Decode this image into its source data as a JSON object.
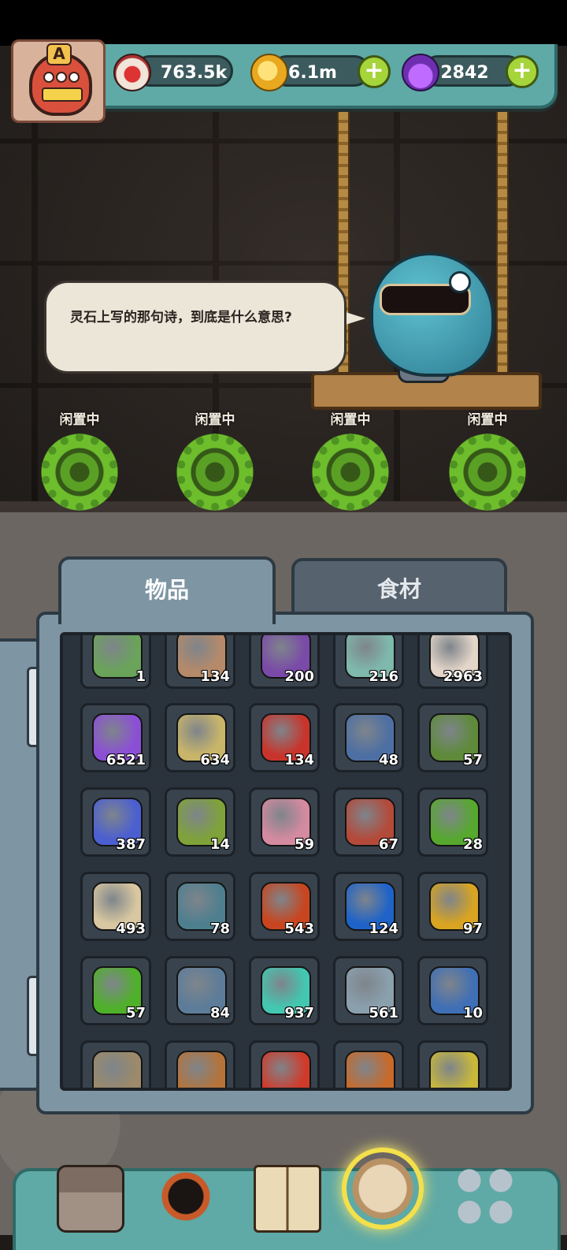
{
  "resources": {
    "eyes": "763.5k",
    "coins": "6.1m",
    "potions": "2842",
    "add_symbol": "+"
  },
  "avatar": {
    "rank_letter": "A"
  },
  "dialogue": {
    "text": "灵石上写的那句诗，到底是什么意思?"
  },
  "slots": [
    {
      "status": "闲置中"
    },
    {
      "status": "闲置中"
    },
    {
      "status": "闲置中"
    },
    {
      "status": "闲置中"
    }
  ],
  "tabs": {
    "items": "物品",
    "ingredients": "食材"
  },
  "inventory": [
    {
      "icon": "bottle-green-icon",
      "count": "1",
      "color": "#6aa35a"
    },
    {
      "icon": "map-scroll-icon",
      "count": "134",
      "color": "#b58a6a"
    },
    {
      "icon": "purple-device-icon",
      "count": "200",
      "color": "#7a4aa8"
    },
    {
      "icon": "bottle-teal-icon",
      "count": "216",
      "color": "#7fb9ad"
    },
    {
      "icon": "red-flower-card-icon",
      "count": "2963",
      "color": "#e3d5c8"
    },
    {
      "icon": "purple-powder-icon",
      "count": "6521",
      "color": "#8b4fd6"
    },
    {
      "icon": "cassette-map-icon",
      "count": "634",
      "color": "#c9b56a"
    },
    {
      "icon": "red-barrel-icon",
      "count": "134",
      "color": "#c8342b"
    },
    {
      "icon": "blue-machine-card-icon",
      "count": "48",
      "color": "#4d6fa3"
    },
    {
      "icon": "spirit-card-icon",
      "count": "57",
      "color": "#5e8a3a"
    },
    {
      "icon": "blue-crystal-icon",
      "count": "387",
      "color": "#4b5fd1"
    },
    {
      "icon": "mossy-rock-icon",
      "count": "14",
      "color": "#7fa23a"
    },
    {
      "icon": "pink-scroll-icon",
      "count": "59",
      "color": "#d48aa0"
    },
    {
      "icon": "red-machine-card-icon",
      "count": "67",
      "color": "#b34a3a"
    },
    {
      "icon": "four-leaf-clover-icon",
      "count": "28",
      "color": "#56a82e"
    },
    {
      "icon": "coin-pile-icon",
      "count": "493",
      "color": "#d8c7a0"
    },
    {
      "icon": "blob-badge-icon",
      "count": "78",
      "color": "#4e7f8f"
    },
    {
      "icon": "red-triangle-gem-icon",
      "count": "543",
      "color": "#c8451f"
    },
    {
      "icon": "blue-square-gem-icon",
      "count": "124",
      "color": "#1f63c8"
    },
    {
      "icon": "gold-pentagon-gem-icon",
      "count": "97",
      "color": "#d8a422"
    },
    {
      "icon": "green-hexagon-gem-icon",
      "count": "57",
      "color": "#4fb02a"
    },
    {
      "icon": "gear-scroll-icon",
      "count": "84",
      "color": "#5c7c9a"
    },
    {
      "icon": "teal-ghost-icon",
      "count": "937",
      "color": "#43c7b0"
    },
    {
      "icon": "blob-necklace-icon",
      "count": "561",
      "color": "#8aa0ad"
    },
    {
      "icon": "tin-can-icon",
      "count": "10",
      "color": "#3f6fb5"
    },
    {
      "icon": "bone-whip-icon",
      "count": "",
      "color": "#9c8a6a"
    },
    {
      "icon": "lute-icon",
      "count": "",
      "color": "#b5733a"
    },
    {
      "icon": "red-urchin-icon",
      "count": "",
      "color": "#d03a2a"
    },
    {
      "icon": "feather-icon",
      "count": "",
      "color": "#c86a2a"
    },
    {
      "icon": "yellow-sprout-icon",
      "count": "",
      "color": "#c9b83a"
    }
  ],
  "nav": [
    {
      "icon": "shop-building-icon"
    },
    {
      "icon": "monster-portrait-icon"
    },
    {
      "icon": "recipe-book-icon"
    },
    {
      "icon": "coin-bag-icon",
      "active": true
    },
    {
      "icon": "grid-menu-icon"
    }
  ]
}
